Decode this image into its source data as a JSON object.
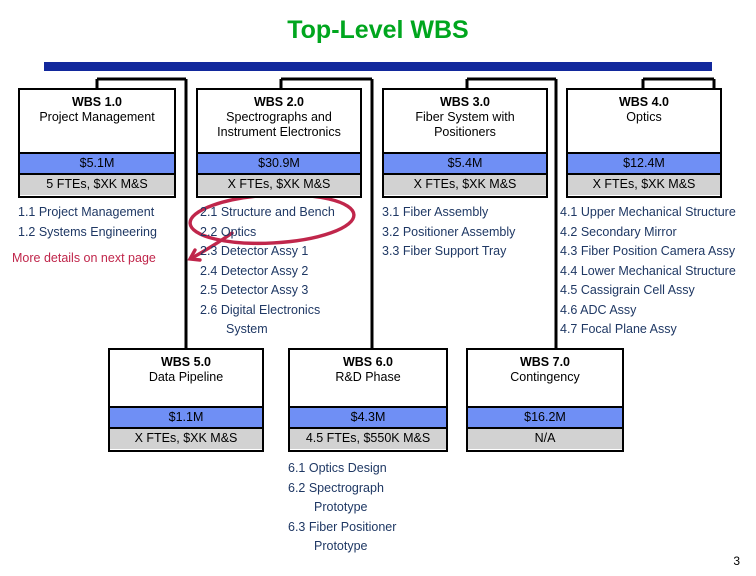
{
  "slide": {
    "title": "Top-Level WBS",
    "page_number": "3",
    "title_color": "#00a61e",
    "bar_color": "#12289c",
    "money_band_color": "#6f8ff5",
    "fte_band_color": "#d2d2d2",
    "sub_item_color": "#1f3864",
    "annotation_color": "#c0264b"
  },
  "annotation": {
    "note": "More details on next page"
  },
  "boxes": [
    {
      "code": "WBS 1.0",
      "name": "Project Management",
      "money": "$5.1M",
      "ftes": "5 FTEs, $XK M&S",
      "items": [
        "1.1 Project Management",
        "1.2 Systems Engineering"
      ]
    },
    {
      "code": "WBS 2.0",
      "name": "Spectrographs and Instrument Electronics",
      "money": "$30.9M",
      "ftes": "X FTEs, $XK M&S",
      "items": [
        "2.1 Structure and Bench",
        "2.2 Optics",
        "2.3 Detector Assy 1",
        "2.4 Detector Assy 2",
        "2.5 Detector Assy 3",
        "2.6 Digital Electronics System"
      ]
    },
    {
      "code": "WBS 3.0",
      "name": "Fiber System with Positioners",
      "money": "$5.4M",
      "ftes": "X FTEs, $XK M&S",
      "items": [
        "3.1 Fiber Assembly",
        "3.2 Positioner Assembly",
        "3.3 Fiber Support Tray"
      ]
    },
    {
      "code": "WBS 4.0",
      "name": "Optics",
      "money": "$12.4M",
      "ftes": "X FTEs, $XK M&S",
      "items": [
        "4.1 Upper Mechanical Structure",
        "4.2 Secondary Mirror",
        "4.3 Fiber Position Camera Assy",
        "4.4 Lower Mechanical Structure",
        "4.5 Cassigrain Cell Assy",
        "4.6 ADC Assy",
        "4.7 Focal Plane Assy"
      ]
    },
    {
      "code": "WBS 5.0",
      "name": "Data Pipeline",
      "money": "$1.1M",
      "ftes": "X FTEs, $XK M&S",
      "items": []
    },
    {
      "code": "WBS 6.0",
      "name": "R&D Phase",
      "money": "$4.3M",
      "ftes": "4.5 FTEs, $550K M&S",
      "items": [
        "6.1 Optics Design",
        "6.2 Spectrograph Prototype",
        "6.3 Fiber Positioner Prototype"
      ]
    },
    {
      "code": "WBS 7.0",
      "name": "Contingency",
      "money": "$16.2M",
      "ftes": "N/A",
      "items": []
    }
  ]
}
